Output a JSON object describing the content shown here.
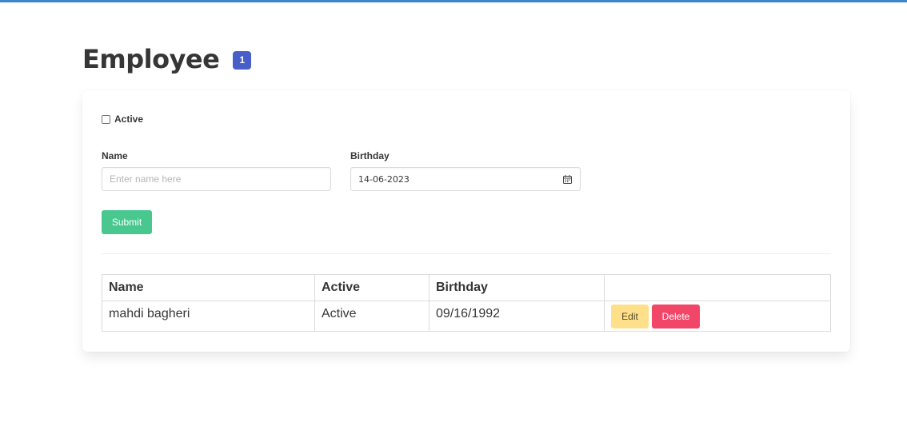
{
  "header": {
    "title": "Employee",
    "count": "1"
  },
  "form": {
    "active_label": "Active",
    "active_checked": false,
    "name_label": "Name",
    "name_placeholder": "Enter name here",
    "name_value": "",
    "birthday_label": "Birthday",
    "birthday_value": "14-06-2023",
    "submit_label": "Submit"
  },
  "table": {
    "columns": [
      "Name",
      "Active",
      "Birthday",
      ""
    ],
    "rows": [
      {
        "name": "mahdi bagheri",
        "active": "Active",
        "birthday": "09/16/1992",
        "edit_label": "Edit",
        "delete_label": "Delete"
      }
    ]
  },
  "colors": {
    "accent_top_bar": "#3b86c9",
    "tag": "#485fc7",
    "submit": "#48c78e",
    "edit": "#ffe08a",
    "delete": "#f14668"
  },
  "icons": {
    "birthday_picker": "calendar-icon"
  }
}
